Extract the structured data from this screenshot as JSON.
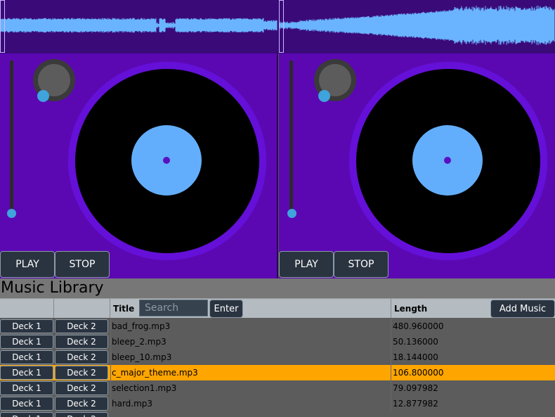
{
  "colors": {
    "waveform_bg": "#3a0a78",
    "waveform": "#6ab4ff",
    "deck_bg": "#5b08b3",
    "platter": "#6510d8",
    "record": "#000000",
    "label": "#63aefc",
    "accent_blue": "#3fa3dc",
    "selected_row": "#ffa500"
  },
  "deck_left": {
    "play_label": "PLAY",
    "stop_label": "STOP"
  },
  "deck_right": {
    "play_label": "PLAY",
    "stop_label": "STOP"
  },
  "library": {
    "title": "Music Library",
    "columns": {
      "title": "Title",
      "length": "Length"
    },
    "search_placeholder": "Search",
    "enter_label": "Enter",
    "add_music_label": "Add Music",
    "deck1_label": "Deck 1",
    "deck2_label": "Deck 2",
    "tracks": [
      {
        "title": "bad_frog.mp3",
        "length": "480.960000",
        "selected": false
      },
      {
        "title": "bleep_2.mp3",
        "length": "50.136000",
        "selected": false
      },
      {
        "title": "bleep_10.mp3",
        "length": "18.144000",
        "selected": false
      },
      {
        "title": "c_major_theme.mp3",
        "length": "106.800000",
        "selected": true
      },
      {
        "title": "selection1.mp3",
        "length": "79.097982",
        "selected": false
      },
      {
        "title": "hard.mp3",
        "length": "12.877982",
        "selected": false
      }
    ]
  }
}
